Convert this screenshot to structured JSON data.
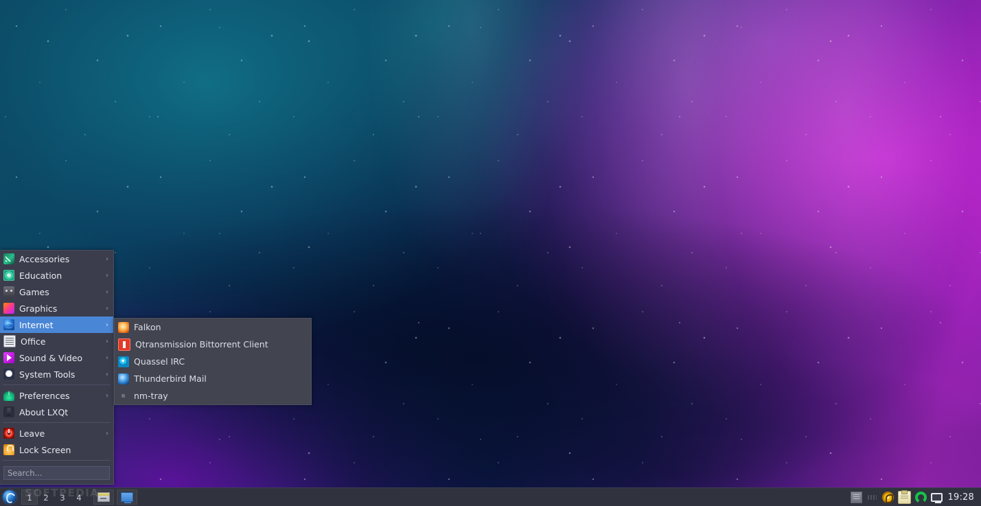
{
  "desktop": {
    "wallpaper_name": "nebula-space-wallpaper",
    "colors": {
      "teal": "#0c4a63",
      "navy": "#091d44",
      "purple": "#6a1fa0",
      "magenta": "#a728c0"
    }
  },
  "watermark": {
    "text": "SOFTPEDIA"
  },
  "menu": {
    "name": "lxqt-application-menu",
    "items": [
      {
        "label": "Accessories",
        "icon": "accessories-icon",
        "arrow": "›",
        "has_submenu": true,
        "selected": false,
        "separator_after": false
      },
      {
        "label": "Education",
        "icon": "education-icon",
        "arrow": "›",
        "has_submenu": true,
        "selected": false,
        "separator_after": false
      },
      {
        "label": "Games",
        "icon": "games-icon",
        "arrow": "›",
        "has_submenu": true,
        "selected": false,
        "separator_after": false
      },
      {
        "label": "Graphics",
        "icon": "graphics-icon",
        "arrow": "›",
        "has_submenu": true,
        "selected": false,
        "separator_after": false
      },
      {
        "label": "Internet",
        "icon": "internet-icon",
        "arrow": "›",
        "has_submenu": true,
        "selected": true,
        "separator_after": false
      },
      {
        "label": "Office",
        "icon": "office-icon",
        "arrow": "›",
        "has_submenu": true,
        "selected": false,
        "separator_after": false
      },
      {
        "label": "Sound & Video",
        "icon": "sound-video-icon",
        "arrow": "›",
        "has_submenu": true,
        "selected": false,
        "separator_after": false
      },
      {
        "label": "System Tools",
        "icon": "system-tools-icon",
        "arrow": "›",
        "has_submenu": true,
        "selected": false,
        "separator_after": true
      },
      {
        "label": "Preferences",
        "icon": "preferences-icon",
        "arrow": "›",
        "has_submenu": true,
        "selected": false,
        "separator_after": false
      },
      {
        "label": "About LXQt",
        "icon": "about-lxqt-icon",
        "arrow": "",
        "has_submenu": false,
        "selected": false,
        "separator_after": true
      },
      {
        "label": "Leave",
        "icon": "leave-icon",
        "arrow": "›",
        "has_submenu": true,
        "selected": false,
        "separator_after": false
      },
      {
        "label": "Lock Screen",
        "icon": "lock-screen-icon",
        "arrow": "",
        "has_submenu": false,
        "selected": false,
        "separator_after": true
      }
    ],
    "search": {
      "value": "",
      "placeholder": "Search..."
    }
  },
  "submenu": {
    "parent": "Internet",
    "items": [
      {
        "label": "Falkon",
        "icon": "falkon-icon"
      },
      {
        "label": "Qtransmission Bittorrent Client",
        "icon": "qtransmission-icon"
      },
      {
        "label": "Quassel IRC",
        "icon": "quassel-icon"
      },
      {
        "label": "Thunderbird Mail",
        "icon": "thunderbird-icon"
      },
      {
        "label": "nm-tray",
        "icon": "nm-tray-icon"
      }
    ]
  },
  "panel": {
    "start_button": {
      "label": "",
      "icon": "lxqt-start-icon"
    },
    "pager": {
      "desktops": [
        {
          "label": "1",
          "active": true
        },
        {
          "label": "2",
          "active": false
        },
        {
          "label": "3",
          "active": false
        },
        {
          "label": "4",
          "active": false
        }
      ]
    },
    "tasks": [
      {
        "label": "",
        "icon": "file-manager-icon"
      },
      {
        "label": "",
        "icon": "screen-window-icon"
      }
    ],
    "tray": [
      {
        "name": "tray-unknown-icon",
        "icon": "tray-blank-icon"
      },
      {
        "name": "tray-faded-icon",
        "icon": "tray-dim-icon"
      },
      {
        "name": "clipman-icon",
        "icon": "clipman-icon"
      },
      {
        "name": "clipboard-icon",
        "icon": "clipboard-icon"
      },
      {
        "name": "update-manager-icon",
        "icon": "update-icon"
      },
      {
        "name": "display-monitor-icon",
        "icon": "monitor-icon"
      }
    ],
    "clock": {
      "time": "19:28"
    }
  }
}
